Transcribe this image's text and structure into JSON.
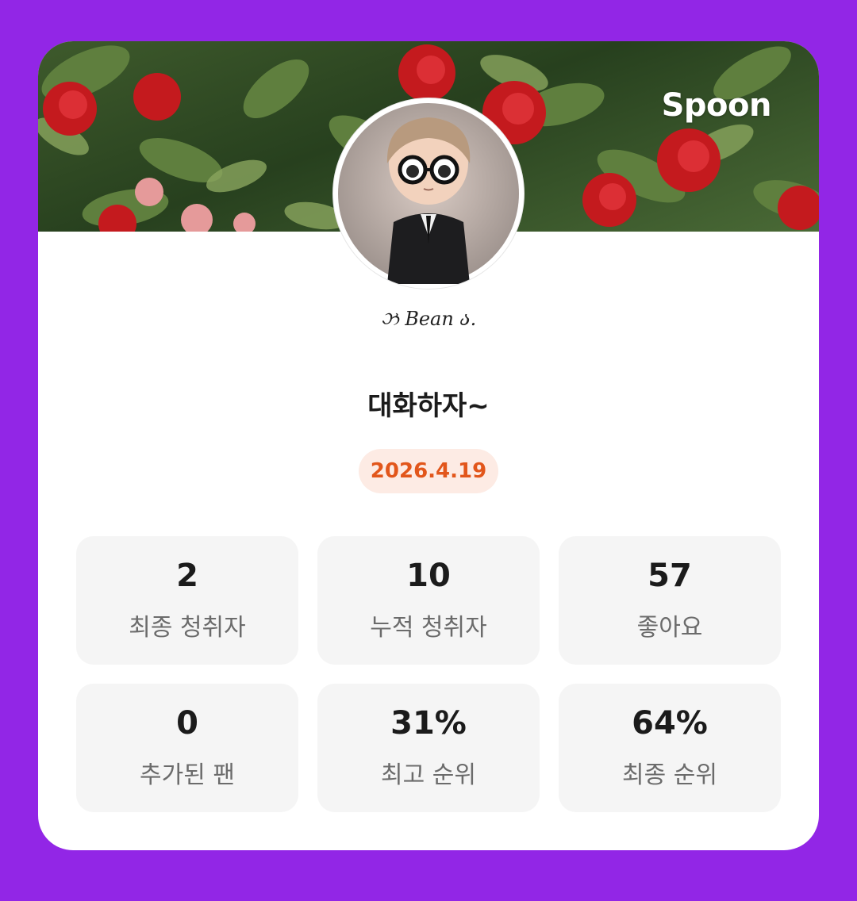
{
  "brand": {
    "logo_text": "Spoon"
  },
  "profile": {
    "nickname": "ઝ Bean ა."
  },
  "live": {
    "title": "대화하자~",
    "date": "2026.4.19"
  },
  "stats": [
    {
      "value": "2",
      "label": "최종 청취자"
    },
    {
      "value": "10",
      "label": "누적 청취자"
    },
    {
      "value": "57",
      "label": "좋아요"
    },
    {
      "value": "0",
      "label": "추가된 팬"
    },
    {
      "value": "31%",
      "label": "최고 순위"
    },
    {
      "value": "64%",
      "label": "최종 순위"
    }
  ],
  "colors": {
    "background": "#9226e6",
    "card": "#ffffff",
    "date_badge_bg": "#fdebe4",
    "date_badge_text": "#e2561b",
    "stat_bg": "#f5f5f5"
  }
}
